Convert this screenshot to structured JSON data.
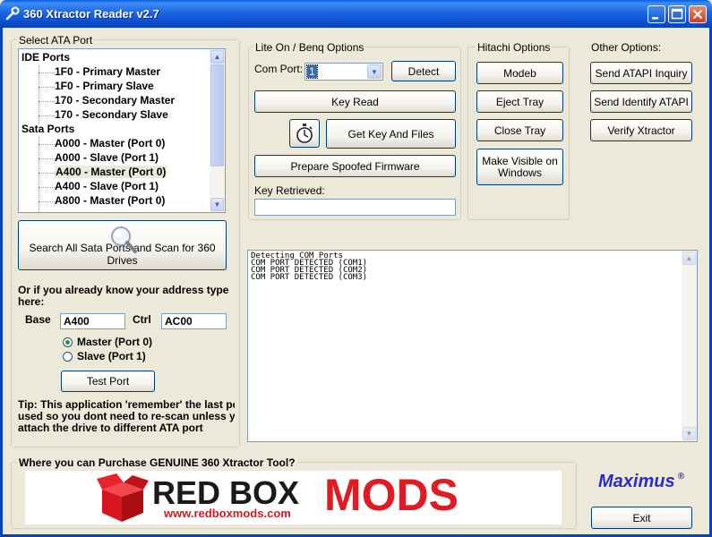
{
  "window": {
    "title": "360 Xtractor Reader v2.7"
  },
  "ata_port": {
    "legend": "Select ATA Port",
    "tree": [
      {
        "label": "IDE Ports",
        "level": 0
      },
      {
        "label": "1F0 - Primary Master",
        "level": 1
      },
      {
        "label": "1F0 - Primary Slave",
        "level": 1
      },
      {
        "label": "170 - Secondary Master",
        "level": 1
      },
      {
        "label": "170 - Secondary Slave",
        "level": 1
      },
      {
        "label": "Sata Ports",
        "level": 0
      },
      {
        "label": "A000 - Master (Port 0)",
        "level": 1
      },
      {
        "label": "A000 - Slave (Port 1)",
        "level": 1
      },
      {
        "label": "A400 - Master (Port 0)",
        "level": 1,
        "selected": true
      },
      {
        "label": "A400 - Slave (Port 1)",
        "level": 1
      },
      {
        "label": "A800 - Master (Port 0)",
        "level": 1
      }
    ],
    "scan_button": "Search All Sata Ports and Scan for 360 Drives",
    "manual_heading": "Or if you already know your address type here:",
    "base_label": "Base",
    "base_value": "A400",
    "ctrl_label": "Ctrl",
    "ctrl_value": "AC00",
    "master_label": "Master (Port 0)",
    "slave_label": "Slave (Port 1)",
    "test_button": "Test Port",
    "tip": "Tip: This application 'remember' the last port used so you dont need to re-scan unless you attach the drive to different ATA port"
  },
  "liteon": {
    "legend": "Lite On / Benq Options",
    "com_port_label": "Com Port:",
    "com_port_value": "1",
    "detect_button": "Detect",
    "key_read_button": "Key Read",
    "get_key_button": "Get Key And Files",
    "prepare_button": "Prepare Spoofed Firmware",
    "key_retrieved_label": "Key Retrieved:",
    "key_retrieved_value": ""
  },
  "hitachi": {
    "legend": "Hitachi Options",
    "modeb_button": "Modeb",
    "eject_button": "Eject Tray",
    "close_button": "Close Tray",
    "visible_button": "Make Visible on Windows"
  },
  "other": {
    "legend": "Other Options:",
    "inquiry_button": "Send ATAPI Inquiry",
    "identify_button": "Send Identify ATAPI",
    "verify_button": "Verify Xtractor"
  },
  "log": {
    "lines": "Detecting COM Ports\nCOM PORT DETECTED (COM1)\nCOM PORT DETECTED (COM2)\nCOM PORT DETECTED (COM3)"
  },
  "purchase": {
    "legend": "Where you can Purchase GENUINE 360 Xtractor Tool?",
    "banner_word1": "RED BOX",
    "banner_word2": "MODS",
    "banner_url": "www.redboxmods.com"
  },
  "brand": {
    "name": "Maximus",
    "mark": "®"
  },
  "exit_button": "Exit",
  "colors": {
    "titlebar": "#0a5fe0",
    "window_bg": "#ece9d8",
    "banner_red": "#e21a22",
    "brand_blue": "#2a2ad0"
  }
}
